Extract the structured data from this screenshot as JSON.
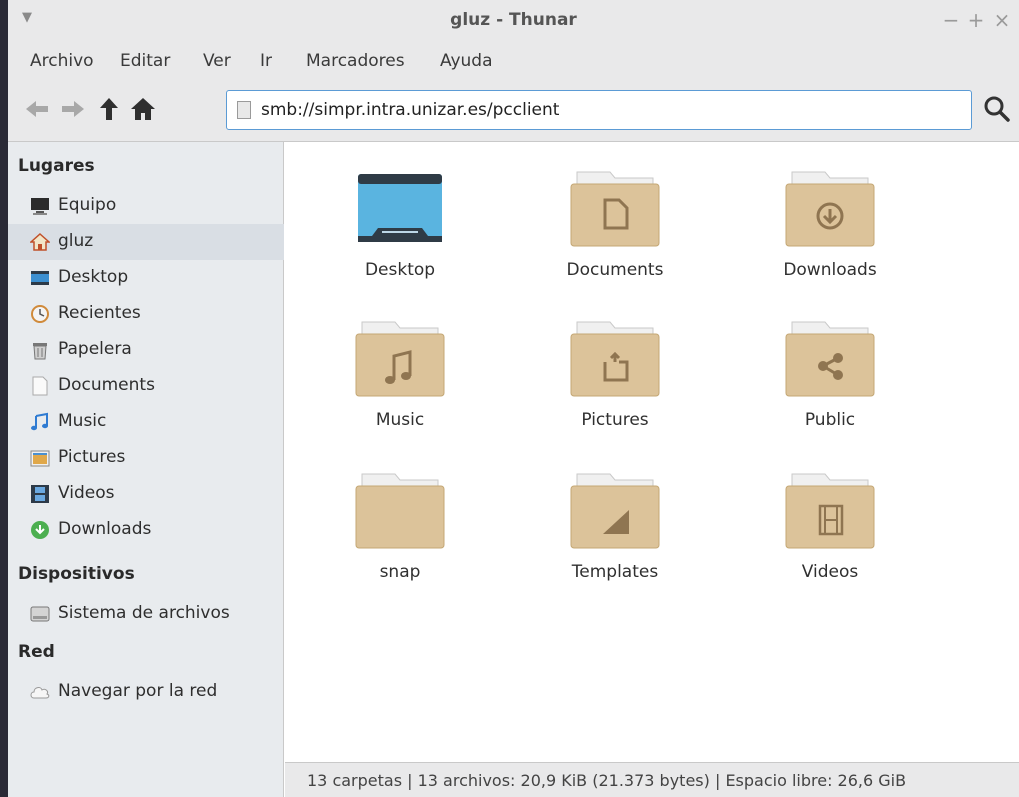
{
  "window": {
    "title": "gluz - Thunar",
    "controls": {
      "minimize": "−",
      "maximize": "+",
      "close": "×"
    }
  },
  "menubar": {
    "items": [
      "Archivo",
      "Editar",
      "Ver",
      "Ir",
      "Marcadores",
      "Ayuda"
    ]
  },
  "toolbar": {
    "icons": [
      "back-arrow-icon",
      "forward-arrow-icon",
      "up-arrow-icon",
      "home-icon",
      "search-icon"
    ],
    "location": "smb://simpr.intra.unizar.es/pcclient"
  },
  "sidebar": {
    "sections": [
      {
        "title": "Lugares",
        "items": [
          {
            "label": "Equipo",
            "icon": "computer-icon"
          },
          {
            "label": "gluz",
            "icon": "home-icon",
            "selected": true
          },
          {
            "label": "Desktop",
            "icon": "desktop-icon"
          },
          {
            "label": "Recientes",
            "icon": "recent-icon"
          },
          {
            "label": "Papelera",
            "icon": "trash-icon"
          },
          {
            "label": "Documents",
            "icon": "document-icon"
          },
          {
            "label": "Music",
            "icon": "music-icon"
          },
          {
            "label": "Pictures",
            "icon": "pictures-icon"
          },
          {
            "label": "Videos",
            "icon": "videos-icon"
          },
          {
            "label": "Downloads",
            "icon": "downloads-icon"
          }
        ]
      },
      {
        "title": "Dispositivos",
        "items": [
          {
            "label": "Sistema de archivos",
            "icon": "drive-icon"
          }
        ]
      },
      {
        "title": "Red",
        "items": [
          {
            "label": "Navegar por la red",
            "icon": "network-icon"
          }
        ]
      }
    ]
  },
  "content": {
    "folders": [
      {
        "label": "Desktop",
        "icon": "desktop-folder-icon"
      },
      {
        "label": "Documents",
        "icon": "documents-folder-icon"
      },
      {
        "label": "Downloads",
        "icon": "downloads-folder-icon"
      },
      {
        "label": "Music",
        "icon": "music-folder-icon"
      },
      {
        "label": "Pictures",
        "icon": "pictures-folder-icon"
      },
      {
        "label": "Public",
        "icon": "public-folder-icon"
      },
      {
        "label": "snap",
        "icon": "folder-icon"
      },
      {
        "label": "Templates",
        "icon": "templates-folder-icon"
      },
      {
        "label": "Videos",
        "icon": "videos-folder-icon"
      }
    ]
  },
  "statusbar": {
    "text": "13 carpetas  |  13 archivos: 20,9 KiB (21.373 bytes)  |  Espacio libre: 26,6 GiB"
  },
  "colors": {
    "folder": "#dcc39a",
    "accent": "#5b9bd5",
    "sidebar": "#e8ebee"
  }
}
